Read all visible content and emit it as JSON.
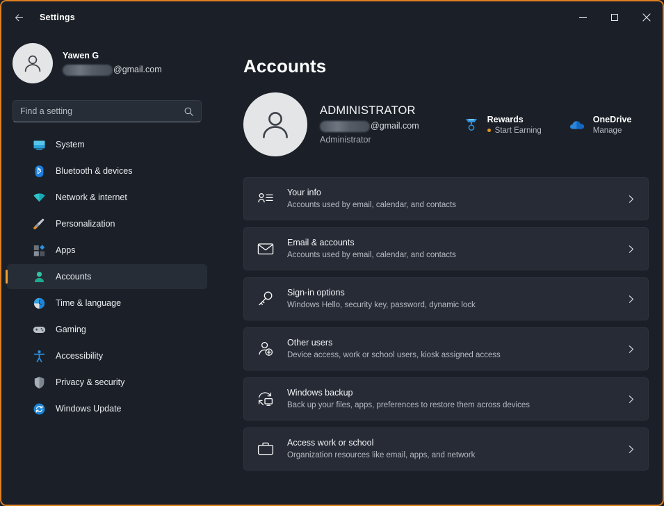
{
  "window": {
    "title": "Settings",
    "back_icon": "back-arrow-icon",
    "minimize_label": "Minimize",
    "maximize_label": "Maximize",
    "close_label": "Close",
    "border_color": "#e08020"
  },
  "profile": {
    "name": "Yawen G",
    "email_domain": "@gmail.com",
    "email_redacted": true,
    "avatar_icon": "person-avatar-icon"
  },
  "search": {
    "placeholder": "Find a setting",
    "value": "",
    "icon": "search-icon"
  },
  "sidebar": {
    "items": [
      {
        "label": "System",
        "icon": "monitor-icon",
        "selected": false
      },
      {
        "label": "Bluetooth & devices",
        "icon": "bluetooth-icon",
        "selected": false
      },
      {
        "label": "Network & internet",
        "icon": "wifi-icon",
        "selected": false
      },
      {
        "label": "Personalization",
        "icon": "paintbrush-icon",
        "selected": false
      },
      {
        "label": "Apps",
        "icon": "apps-grid-icon",
        "selected": false
      },
      {
        "label": "Accounts",
        "icon": "person-icon",
        "selected": true
      },
      {
        "label": "Time & language",
        "icon": "clock-icon",
        "selected": false
      },
      {
        "label": "Gaming",
        "icon": "gamepad-icon",
        "selected": false
      },
      {
        "label": "Accessibility",
        "icon": "accessibility-icon",
        "selected": false
      },
      {
        "label": "Privacy & security",
        "icon": "shield-icon",
        "selected": false
      },
      {
        "label": "Windows Update",
        "icon": "update-refresh-icon",
        "selected": false
      }
    ],
    "selected_accent": "#f0a030"
  },
  "main": {
    "title": "Accounts",
    "account": {
      "name": "ADMINISTRATOR",
      "email_domain": "@gmail.com",
      "email_redacted": true,
      "role": "Administrator",
      "avatar_icon": "person-avatar-icon"
    },
    "hubs": [
      {
        "title": "Rewards",
        "subtitle": "Start Earning",
        "icon": "rewards-medal-icon",
        "has_dot": true,
        "dot_color": "#e59420"
      },
      {
        "title": "OneDrive",
        "subtitle": "Manage",
        "icon": "onedrive-cloud-icon",
        "has_dot": false
      }
    ],
    "cards": [
      {
        "title": "Your info",
        "subtitle": "Accounts used by email, calendar, and contacts",
        "icon": "contact-card-icon",
        "chevron": "chevron-right-icon"
      },
      {
        "title": "Email & accounts",
        "subtitle": "Accounts used by email, calendar, and contacts",
        "icon": "envelope-icon",
        "chevron": "chevron-right-icon"
      },
      {
        "title": "Sign-in options",
        "subtitle": "Windows Hello, security key, password, dynamic lock",
        "icon": "key-icon",
        "chevron": "chevron-right-icon"
      },
      {
        "title": "Other users",
        "subtitle": "Device access, work or school users, kiosk assigned access",
        "icon": "person-add-icon",
        "chevron": "chevron-right-icon"
      },
      {
        "title": "Windows backup",
        "subtitle": "Back up your files, apps, preferences to restore them across devices",
        "icon": "backup-sync-icon",
        "chevron": "chevron-right-icon"
      },
      {
        "title": "Access work or school",
        "subtitle": "Organization resources like email, apps, and network",
        "icon": "briefcase-icon",
        "chevron": "chevron-right-icon"
      }
    ]
  }
}
